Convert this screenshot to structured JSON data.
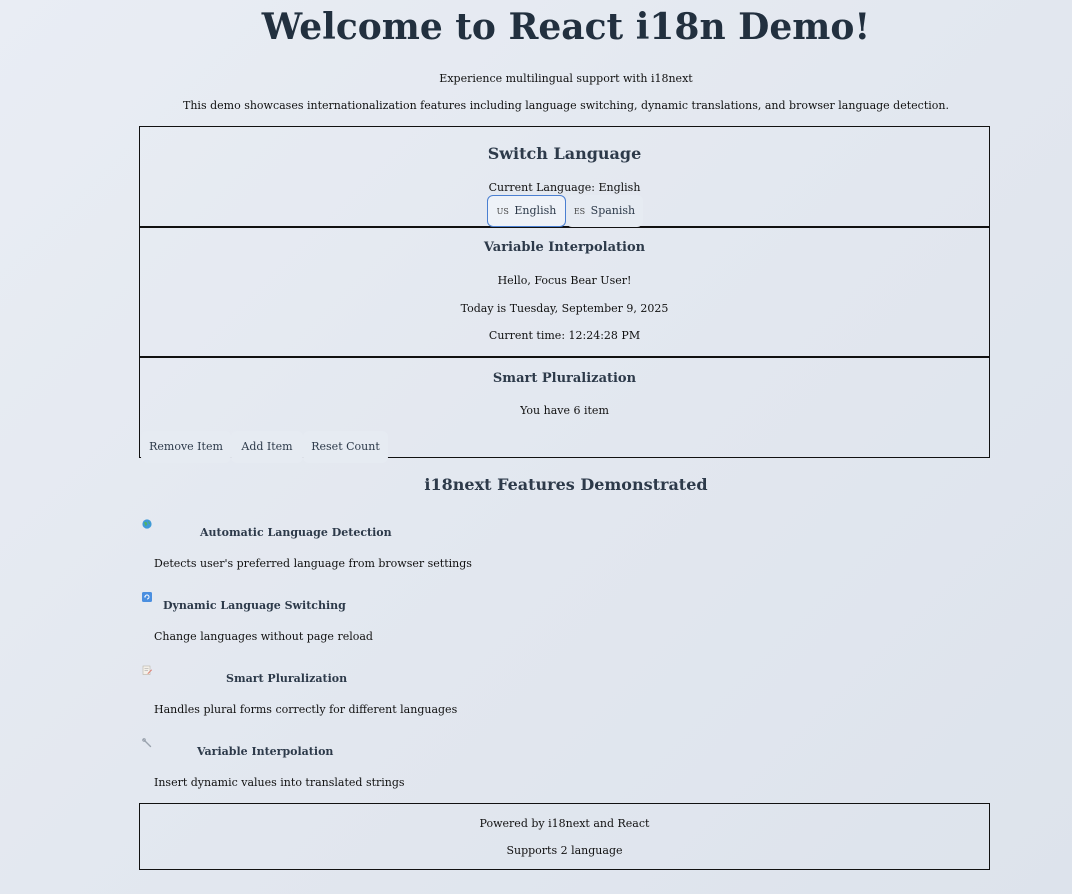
{
  "header": {
    "title": "Welcome to React i18n Demo!",
    "subtitle": "Experience multilingual support with i18next",
    "description": "This demo showcases internationalization features including language switching, dynamic translations, and browser language detection."
  },
  "language_switcher": {
    "title": "Switch Language",
    "current_label": "Current Language: English",
    "buttons": [
      {
        "flag": "US",
        "label": "English",
        "active": true
      },
      {
        "flag": "ES",
        "label": "Spanish",
        "active": false
      }
    ]
  },
  "interpolation": {
    "title": "Variable Interpolation",
    "greeting": "Hello, Focus Bear User!",
    "date": "Today is Tuesday, September 9, 2025",
    "time": "Current time: 12:24:28 PM"
  },
  "pluralization": {
    "title": "Smart Pluralization",
    "count_text": "You have 6 item",
    "buttons": {
      "remove": "Remove Item",
      "add": "Add Item",
      "reset": "Reset Count"
    }
  },
  "features": {
    "title": "i18next Features Demonstrated",
    "items": [
      {
        "icon": "globe-icon",
        "title": "Automatic Language Detection",
        "description": "Detects user's preferred language from browser settings"
      },
      {
        "icon": "refresh-icon",
        "title": "Dynamic Language Switching",
        "description": "Change languages without page reload"
      },
      {
        "icon": "memo-icon",
        "title": "Smart Pluralization",
        "description": "Handles plural forms correctly for different languages"
      },
      {
        "icon": "wrench-icon",
        "title": "Variable Interpolation",
        "description": "Insert dynamic values into translated strings"
      }
    ]
  },
  "footer": {
    "powered_by": "Powered by i18next and React",
    "supports": "Supports 2 language"
  },
  "colors": {
    "heading": "#22303f",
    "accent_border": "#4a7fd1",
    "button_bg": "#e6ebf2"
  }
}
